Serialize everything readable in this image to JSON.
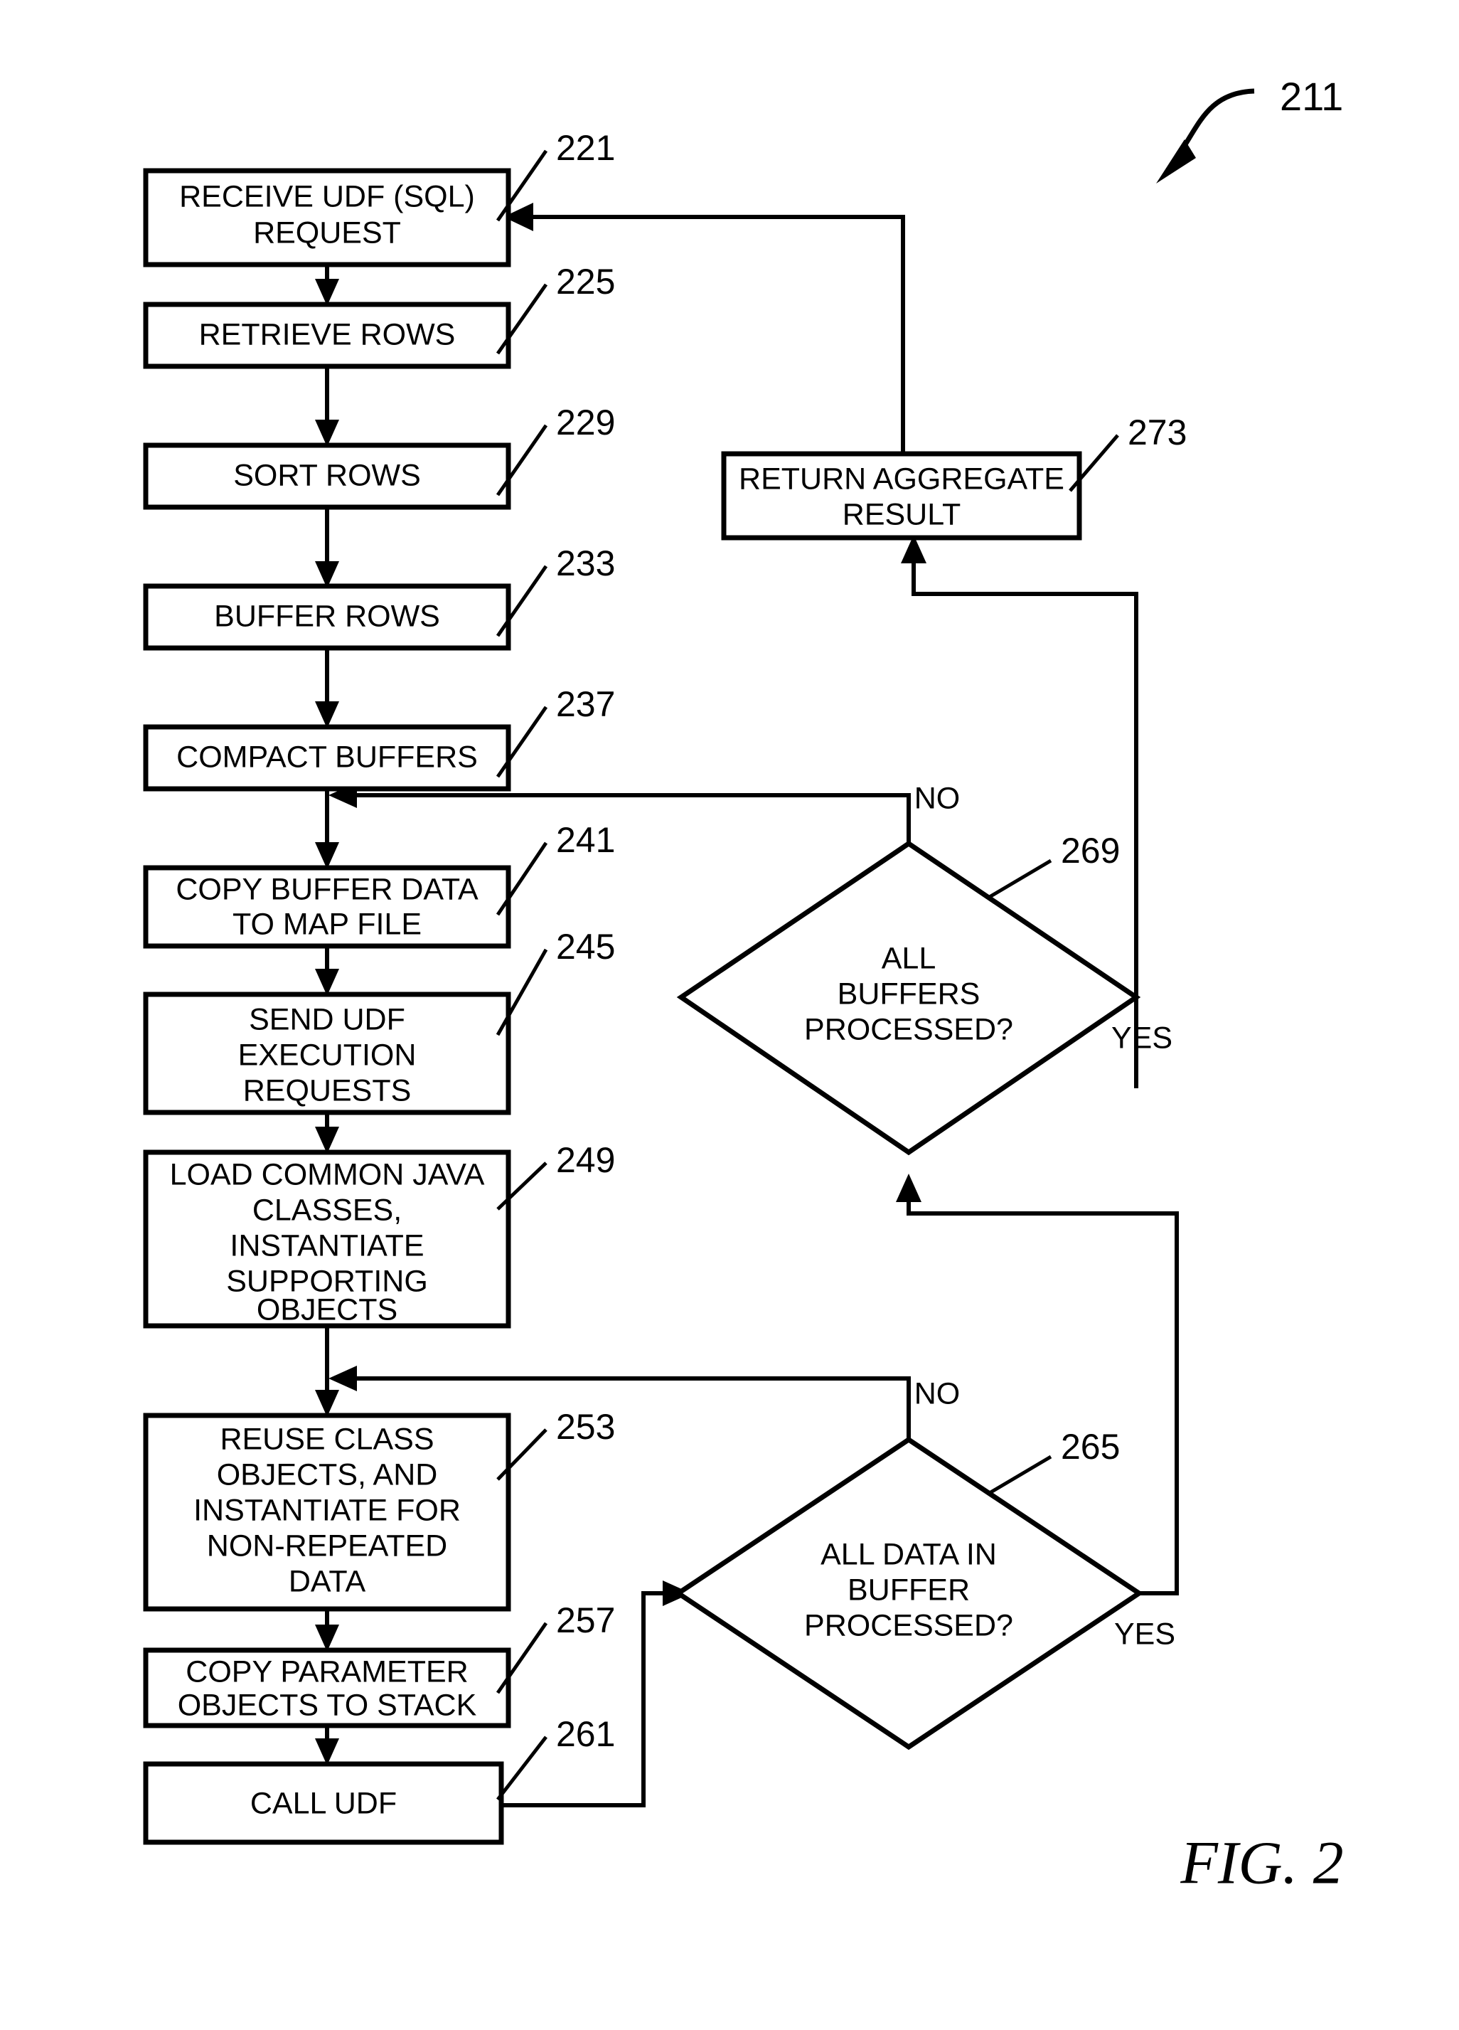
{
  "figure": {
    "caption": "FIG. 2",
    "diagram_ref": "211"
  },
  "chart_data": {
    "type": "diagram",
    "subtype": "flowchart",
    "title": "FIG. 2",
    "diagram_reference_numeral": "211",
    "nodes": [
      {
        "id": "221",
        "ref": "221",
        "shape": "process",
        "lines": [
          "RECEIVE UDF (SQL)",
          "REQUEST"
        ],
        "text": "RECEIVE UDF (SQL) REQUEST"
      },
      {
        "id": "225",
        "ref": "225",
        "shape": "process",
        "lines": [
          "RETRIEVE ROWS"
        ],
        "text": "RETRIEVE ROWS"
      },
      {
        "id": "229",
        "ref": "229",
        "shape": "process",
        "lines": [
          "SORT ROWS"
        ],
        "text": "SORT ROWS"
      },
      {
        "id": "233",
        "ref": "233",
        "shape": "process",
        "lines": [
          "BUFFER ROWS"
        ],
        "text": "BUFFER ROWS"
      },
      {
        "id": "237",
        "ref": "237",
        "shape": "process",
        "lines": [
          "COMPACT BUFFERS"
        ],
        "text": "COMPACT BUFFERS"
      },
      {
        "id": "241",
        "ref": "241",
        "shape": "process",
        "lines": [
          "COPY BUFFER DATA",
          "TO MAP FILE"
        ],
        "text": "COPY BUFFER DATA TO MAP FILE"
      },
      {
        "id": "245",
        "ref": "245",
        "shape": "process",
        "lines": [
          "SEND UDF",
          "EXECUTION",
          "REQUESTS"
        ],
        "text": "SEND UDF EXECUTION REQUESTS"
      },
      {
        "id": "249",
        "ref": "249",
        "shape": "process",
        "lines": [
          "LOAD COMMON JAVA",
          "CLASSES,",
          "INSTANTIATE",
          "SUPPORTING",
          "OBJECTS"
        ],
        "text": "LOAD COMMON JAVA CLASSES, INSTANTIATE SUPPORTING OBJECTS"
      },
      {
        "id": "253",
        "ref": "253",
        "shape": "process",
        "lines": [
          "REUSE CLASS",
          "OBJECTS, AND",
          "INSTANTIATE FOR",
          "NON-REPEATED",
          "DATA"
        ],
        "text": "REUSE CLASS OBJECTS, AND INSTANTIATE FOR NON-REPEATED DATA"
      },
      {
        "id": "257",
        "ref": "257",
        "shape": "process",
        "lines": [
          "COPY PARAMETER",
          "OBJECTS TO STACK"
        ],
        "text": "COPY PARAMETER OBJECTS TO STACK"
      },
      {
        "id": "261",
        "ref": "261",
        "shape": "process",
        "lines": [
          "CALL UDF"
        ],
        "text": "CALL UDF"
      },
      {
        "id": "265",
        "ref": "265",
        "shape": "decision",
        "lines": [
          "ALL DATA IN",
          "BUFFER",
          "PROCESSED?"
        ],
        "text": "ALL DATA IN BUFFER PROCESSED?"
      },
      {
        "id": "269",
        "ref": "269",
        "shape": "decision",
        "lines": [
          "ALL",
          "BUFFERS",
          "PROCESSED?"
        ],
        "text": "ALL BUFFERS PROCESSED?"
      },
      {
        "id": "273",
        "ref": "273",
        "shape": "process",
        "lines": [
          "RETURN AGGREGATE",
          "RESULT"
        ],
        "text": "RETURN AGGREGATE RESULT"
      }
    ],
    "edges": [
      {
        "from": "221",
        "to": "225",
        "label": ""
      },
      {
        "from": "225",
        "to": "229",
        "label": ""
      },
      {
        "from": "229",
        "to": "233",
        "label": ""
      },
      {
        "from": "233",
        "to": "237",
        "label": ""
      },
      {
        "from": "237",
        "to": "241",
        "label": ""
      },
      {
        "from": "241",
        "to": "245",
        "label": ""
      },
      {
        "from": "245",
        "to": "249",
        "label": ""
      },
      {
        "from": "249",
        "to": "253",
        "label": ""
      },
      {
        "from": "253",
        "to": "257",
        "label": ""
      },
      {
        "from": "257",
        "to": "261",
        "label": ""
      },
      {
        "from": "261",
        "to": "265",
        "label": ""
      },
      {
        "from": "265",
        "to": "253",
        "label": "NO"
      },
      {
        "from": "265",
        "to": "269",
        "label": "YES"
      },
      {
        "from": "269",
        "to": "241",
        "label": "NO"
      },
      {
        "from": "269",
        "to": "273",
        "label": "YES"
      },
      {
        "from": "273",
        "to": "221",
        "label": ""
      }
    ],
    "edge_labels": {
      "decision_269_no": "NO",
      "decision_269_yes": "YES",
      "decision_265_no": "NO",
      "decision_265_yes": "YES"
    }
  }
}
